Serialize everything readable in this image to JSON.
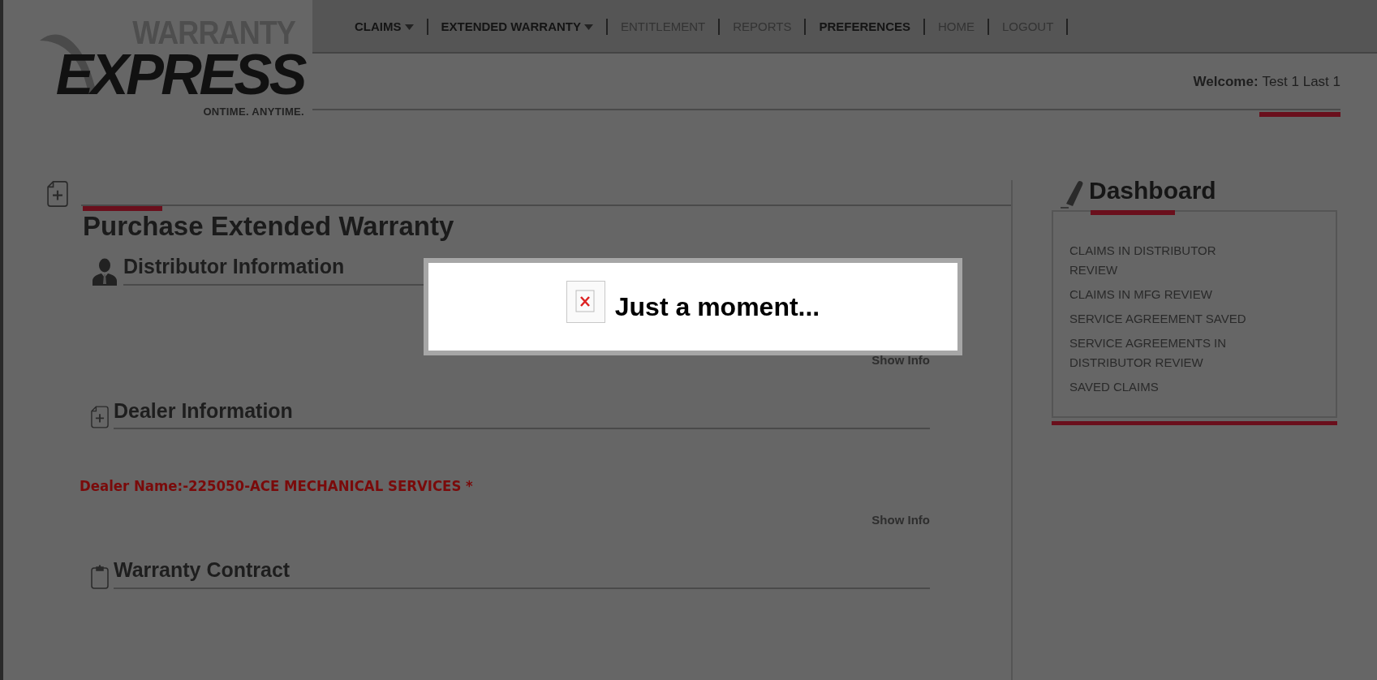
{
  "logo": {
    "top": "WARRANTY",
    "main": "EXPRESS",
    "tagline": "ONTIME. ANYTIME."
  },
  "nav": [
    {
      "label": "CLAIMS",
      "has_menu": true,
      "disabled": false
    },
    {
      "label": "EXTENDED WARRANTY",
      "has_menu": true,
      "disabled": false
    },
    {
      "label": "ENTITLEMENT",
      "has_menu": false,
      "disabled": true
    },
    {
      "label": "REPORTS",
      "has_menu": false,
      "disabled": true
    },
    {
      "label": "PREFERENCES",
      "has_menu": false,
      "disabled": false
    },
    {
      "label": "HOME",
      "has_menu": false,
      "disabled": true
    },
    {
      "label": "LOGOUT",
      "has_menu": false,
      "disabled": true
    }
  ],
  "welcome": {
    "label": "Welcome:",
    "name": "Test 1 Last 1"
  },
  "page_title": "Purchase Extended Warranty",
  "sections": [
    {
      "title": "Distributor Information",
      "link": "Show Info"
    },
    {
      "title": "Dealer Information",
      "note": "Dealer Name:-225050-ACE MECHANICAL SERVICES *",
      "link": "Show Info"
    },
    {
      "title": "Warranty Contract"
    }
  ],
  "dashboard": {
    "title": "Dashboard",
    "items": [
      "CLAIMS IN DISTRIBUTOR REVIEW",
      "CLAIMS IN MFG REVIEW",
      "SERVICE AGREEMENT SAVED",
      "SERVICE AGREEMENTS IN DISTRIBUTOR REVIEW",
      "SAVED CLAIMS"
    ]
  },
  "modal": {
    "message": "Just a moment..."
  }
}
